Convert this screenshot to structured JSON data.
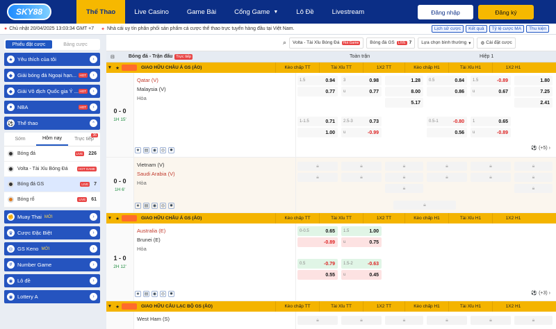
{
  "brand": "SKY88",
  "nav": {
    "items": [
      "Thể Thao",
      "Live Casino",
      "Game Bài",
      "Cổng Game",
      "Lô Đề",
      "Livestream"
    ],
    "login": "Đăng nhập",
    "register": "Đăng ký"
  },
  "subbar": {
    "date": "Chủ nhật 20/04/2025 13:03:34 GMT +7",
    "notice": "Nhà cái uy tín phân phối sản phẩm cá cược thể thao trực tuyến hàng đầu tại Việt Nam.",
    "buttons": [
      "Lịch sử cược",
      "Kết quả",
      "Tỷ lệ cược MA",
      "Thu kiện"
    ]
  },
  "sidebar": {
    "tabs": [
      "Phiếu đặt cược",
      "Bảng cược"
    ],
    "top_items": [
      {
        "label": "Yêu thích của tôi",
        "hot": ""
      },
      {
        "label": "Giải bóng đá Ngoại hạn...",
        "hot": "HOT"
      },
      {
        "label": "Giải Vô địch Quốc gia Ý ...",
        "hot": "HOT"
      },
      {
        "label": "NBA",
        "hot": "HOT"
      },
      {
        "label": "Thể thao",
        "hot": ""
      }
    ],
    "sport_tabs": [
      "Sớm",
      "Hôm nay",
      "Trực tiếp"
    ],
    "sport_tab_badge": "36",
    "sports": [
      {
        "label": "Bóng đá",
        "badge": "LIVE",
        "count": "226"
      },
      {
        "label": "Volta - Tài Xỉu Bóng Đá",
        "badge": "HOT GAME",
        "count": ""
      },
      {
        "label": "Bóng đá GS",
        "badge": "LIVE",
        "count": "7"
      },
      {
        "label": "Bóng rổ",
        "badge": "LIVE",
        "count": "61"
      }
    ],
    "bottom_items": [
      {
        "label": "Muay Thai",
        "tag": "MỚI"
      },
      {
        "label": "Cược Đặc Biệt",
        "tag": ""
      },
      {
        "label": "GS Keno",
        "tag": "MỚI"
      },
      {
        "label": "Number Game",
        "tag": ""
      },
      {
        "label": "Lô đề",
        "tag": ""
      },
      {
        "label": "Lottery A",
        "tag": ""
      }
    ]
  },
  "main": {
    "filter": {
      "volta": "Volta - Tài Xỉu Bóng Đá",
      "volta_tag": "Hot Game",
      "gs": "Bóng đá GS",
      "gs_live": "LIVE",
      "gs_count": "7",
      "sort": "Lựa chọn bình thường",
      "settings": "Cài đặt cược"
    },
    "header": {
      "title": "Bóng đá - Trận đấu",
      "live": "Trực tiếp",
      "full": "Toàn trận",
      "half": "Hiệp 1"
    },
    "groups": [
      {
        "name": "GIAO HỮU CHÂU Á GS (ẢO)"
      },
      {
        "name": "GIAO HỮU CHÂU Á GS (ẢO)"
      },
      {
        "name": "GIAO HỮU CÂU LẠC BỘ GS (ẢO)"
      }
    ],
    "cols": [
      "Kèo chấp TT",
      "Tài Xỉu TT",
      "1X2 TT",
      "Kèo chấp H1",
      "Tài Xỉu H1",
      "1X2 H1"
    ],
    "matches": [
      {
        "score": "0 - 0",
        "time": "1H 15'",
        "home": "Qatar (V)",
        "away": "Malaysia (V)",
        "draw": "Hòa",
        "r1": {
          "hcp": "1.5",
          "h1": "0.94",
          "h2": "0.77",
          "ou": "3",
          "o1": "0.98",
          "u": "u",
          "o2": "0.77",
          "x1": "1.28",
          "x2": "8.00",
          "x3": "5.17",
          "hh": "0.5",
          "hh1": "0.84",
          "hh2": "0.86",
          "ouh": "1.5",
          "ho1": "-0.89",
          "hu": "u",
          "ho2": "0.67",
          "hx1": "1.80",
          "hx2": "7.25",
          "hx3": "2.41"
        },
        "r2": {
          "hcp": "1-1.5",
          "h1": "0.71",
          "h2": "1.00",
          "ou": "2.5-3",
          "o1": "0.73",
          "u": "u",
          "o2": "-0.99",
          "hh": "0.5-1",
          "hh1": "-0.80",
          "hh2": "0.56",
          "ouh": "1",
          "ho1": "0.65",
          "hu": "u",
          "ho2": "-0.89"
        },
        "more": "(+5)"
      },
      {
        "score": "0 - 0",
        "time": "1H 6'",
        "home": "Vietnam (V)",
        "away": "Saudi Arabia (V)",
        "draw": "Hòa"
      },
      {
        "score": "1 - 0",
        "time": "2H 12'",
        "home": "Australia (E)",
        "away": "Brunei (E)",
        "draw": "Hòa",
        "r1": {
          "hcp": "0-0.5",
          "h1": "0.65",
          "h2": "-0.89",
          "ou": "1.5",
          "o1": "1.00",
          "u": "u",
          "o2": "0.75"
        },
        "r2": {
          "hcp": "0.5",
          "h1": "-0.79",
          "h2": "0.55",
          "ou": "1.5-2",
          "o1": "-0.63",
          "u": "u",
          "o2": "0.45"
        },
        "more": "(+3)"
      },
      {
        "home": "West Ham (S)"
      }
    ]
  }
}
